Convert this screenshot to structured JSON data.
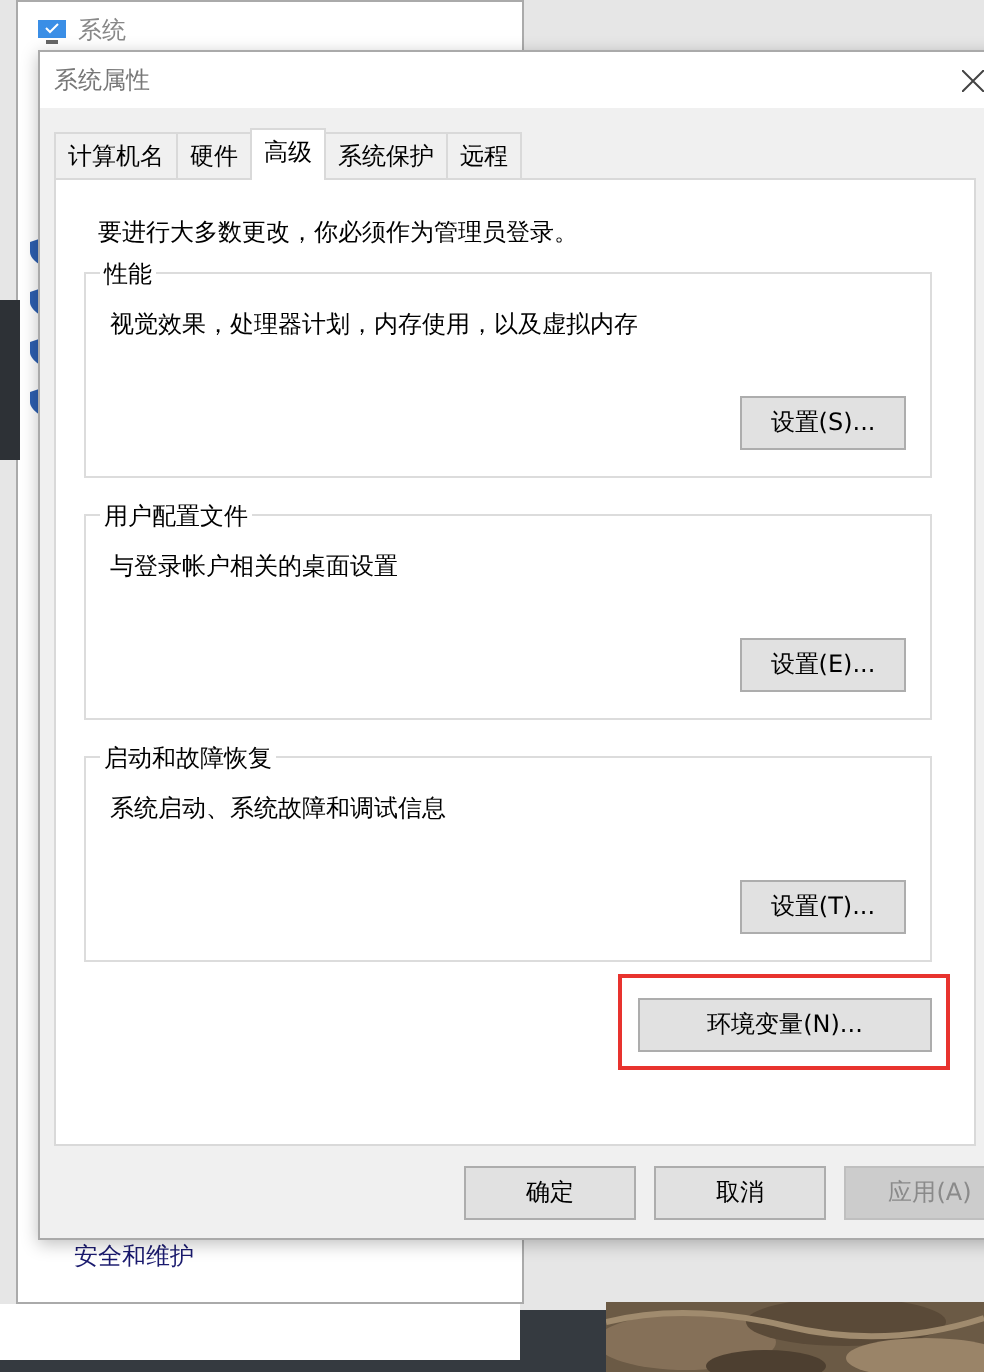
{
  "background_window": {
    "title": "系统",
    "link": "安全和维护"
  },
  "dialog": {
    "title": "系统属性",
    "tabs": [
      {
        "label": "计算机名",
        "selected": false
      },
      {
        "label": "硬件",
        "selected": false
      },
      {
        "label": "高级",
        "selected": true
      },
      {
        "label": "系统保护",
        "selected": false
      },
      {
        "label": "远程",
        "selected": false
      }
    ],
    "notice": "要进行大多数更改，你必须作为管理员登录。",
    "groups": [
      {
        "title": "性能",
        "description": "视觉效果，处理器计划，内存使用，以及虚拟内存",
        "button": "设置(S)..."
      },
      {
        "title": "用户配置文件",
        "description": "与登录帐户相关的桌面设置",
        "button": "设置(E)..."
      },
      {
        "title": "启动和故障恢复",
        "description": "系统启动、系统故障和调试信息",
        "button": "设置(T)..."
      }
    ],
    "env_button": {
      "label": "环境变量(N)...",
      "highlighted": true
    },
    "buttons": [
      {
        "label": "确定",
        "disabled": false
      },
      {
        "label": "取消",
        "disabled": false
      },
      {
        "label": "应用(A)",
        "disabled": true
      }
    ]
  }
}
